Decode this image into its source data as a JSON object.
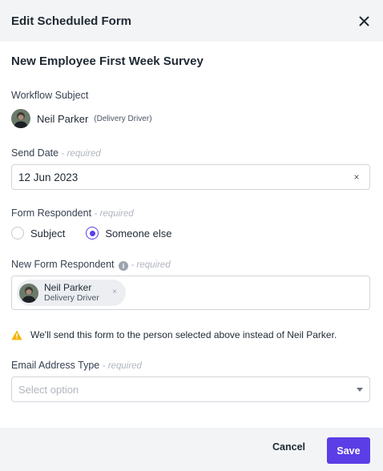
{
  "modal": {
    "title": "Edit Scheduled Form",
    "close_icon": "close-icon"
  },
  "form": {
    "title": "New Employee First Week Survey"
  },
  "workflow_subject": {
    "label": "Workflow Subject",
    "name": "Neil Parker",
    "role": "(Delivery Driver)"
  },
  "send_date": {
    "label": "Send Date",
    "required": "- required",
    "value": "12 Jun 2023",
    "clear": "×"
  },
  "form_respondent": {
    "label": "Form Respondent",
    "required": "- required",
    "options": [
      {
        "label": "Subject",
        "selected": false
      },
      {
        "label": "Someone else",
        "selected": true
      }
    ]
  },
  "new_respondent": {
    "label": "New Form Respondent",
    "info": "i",
    "required": "- required",
    "chip": {
      "name": "Neil Parker",
      "role": "Delivery Driver",
      "remove": "×"
    }
  },
  "notice": {
    "icon": "warning-icon",
    "text": "We'll send this form to the person selected above instead of Neil Parker."
  },
  "email_type": {
    "label": "Email Address Type",
    "required": "- required",
    "placeholder": "Select option"
  },
  "footer": {
    "cancel": "Cancel",
    "save": "Save"
  },
  "colors": {
    "accent": "#5b3ee6",
    "warning": "#f5b400",
    "panel": "#f3f4f6"
  }
}
